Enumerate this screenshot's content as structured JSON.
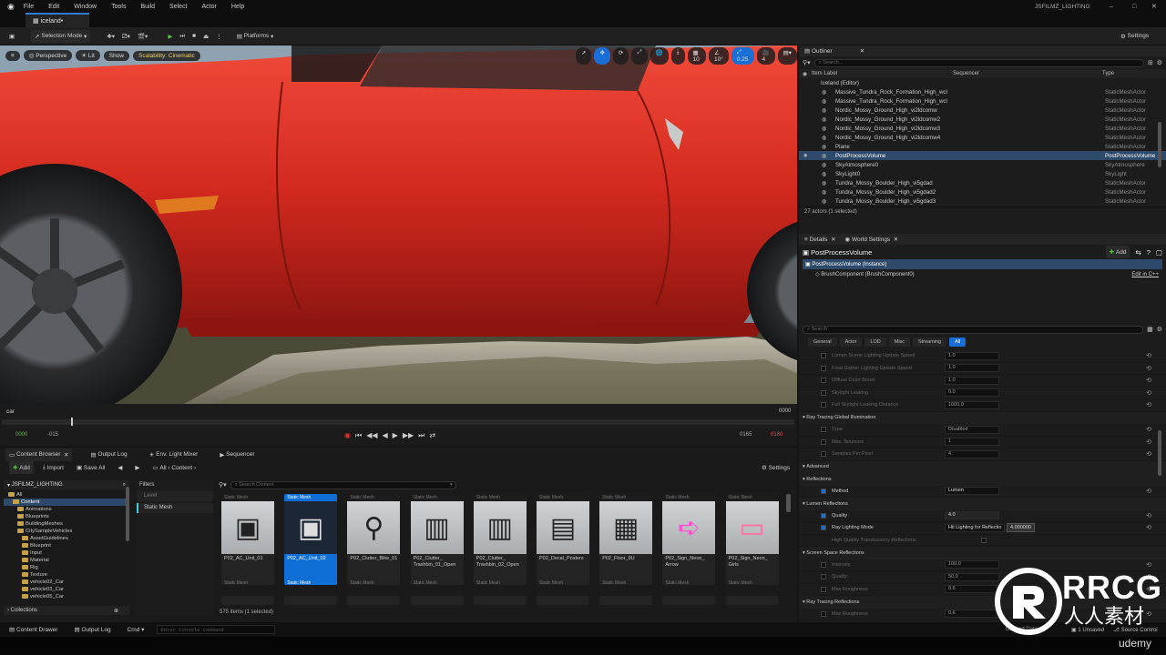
{
  "menu": [
    "File",
    "Edit",
    "Window",
    "Tools",
    "Build",
    "Select",
    "Actor",
    "Help"
  ],
  "project_name": "JSFILMZ_LIGHTING",
  "level_tab": "iceland•",
  "toolbar": {
    "mode": "Selection Mode",
    "platforms": "Platforms",
    "settings": "Settings"
  },
  "viewport": {
    "perspective": "Perspective",
    "lit": "Lit",
    "show": "Show",
    "scalability": "Scalability: Cinematic",
    "grid": "10",
    "angle": "10°",
    "scale": "0.25",
    "camspeed": "4"
  },
  "sequencer": {
    "track": "car",
    "frame_right": "0000",
    "start": "0000",
    "start2": "-015",
    "end": "0165",
    "end2": "0180"
  },
  "dock_tabs": [
    "Content Browser",
    "Output Log",
    "Env. Light Mixer",
    "Sequencer"
  ],
  "content_browser": {
    "add": "Add",
    "import": "Import",
    "save_all": "Save All",
    "path": [
      "All",
      "Content"
    ],
    "settings": "Settings",
    "root": "JSFILMZ_LIGHTING",
    "tree": [
      "All",
      "Content",
      "Animations",
      "Blueprints",
      "BuildingMeshes",
      "CitySampleVehicles",
      "AssetGuidelines",
      "Blueprint",
      "Input",
      "Material",
      "Rig",
      "Texture",
      "vehicle02_Car",
      "vehicle03_Car",
      "vehicle05_Car"
    ],
    "collections": "Collections",
    "filters": "Filters",
    "filter_items": [
      "Level",
      "Static Mesh"
    ],
    "search_placeholder": "Search Content",
    "assets": [
      {
        "type": "Static Mesh",
        "name": "P02_AC_Unit_01",
        "foot": "Static Mesh"
      },
      {
        "type": "Static Mesh",
        "name": "P02_AC_Unit_02",
        "foot": "Static Mesh"
      },
      {
        "type": "Static Mesh",
        "name": "P02_Clutter_Bike_01",
        "foot": "Static Mesh"
      },
      {
        "type": "Static Mesh",
        "name": "P02_Clutter_ Trashbin_01_Open",
        "foot": "Static Mesh"
      },
      {
        "type": "Static Mesh",
        "name": "P02_Clutter_ Trashbin_02_Open",
        "foot": "Static Mesh"
      },
      {
        "type": "Static Mesh",
        "name": "P02_Decal_Posters",
        "foot": "Static Mesh"
      },
      {
        "type": "Static Mesh",
        "name": "P02_Floor_9U",
        "foot": "Static Mesh"
      },
      {
        "type": "Static Mesh",
        "name": "P02_Sign_Neon_ Arrow",
        "foot": "Static Mesh"
      },
      {
        "type": "Static Mesh",
        "name": "P02_Sign_Neon_ Girls",
        "foot": "Static Mesh"
      }
    ],
    "count": "575 items (1 selected)"
  },
  "outliner": {
    "title": "Outliner",
    "search_placeholder": "Search...",
    "col_label": "Item Label",
    "col_seq": "Sequencer",
    "col_type": "Type",
    "root": "Iceland (Editor)",
    "rows": [
      {
        "label": "Massive_Tundra_Rock_Formation_High_wcl",
        "type": "StaticMeshActor"
      },
      {
        "label": "Massive_Tundra_Rock_Formation_High_wcl",
        "type": "StaticMeshActor"
      },
      {
        "label": "Nordic_Mossy_Ground_High_vi2ldcomw",
        "type": "StaticMeshActor"
      },
      {
        "label": "Nordic_Mossy_Ground_High_vi2ldcomw2",
        "type": "StaticMeshActor"
      },
      {
        "label": "Nordic_Mossy_Ground_High_vi2ldcomw3",
        "type": "StaticMeshActor"
      },
      {
        "label": "Nordic_Mossy_Ground_High_vi2ldcomw4",
        "type": "StaticMeshActor"
      },
      {
        "label": "Plane",
        "type": "StaticMeshActor"
      },
      {
        "label": "PostProcessVolume",
        "type": "PostProcessVolume"
      },
      {
        "label": "SkyAtmosphere0",
        "type": "SkyAtmosphere"
      },
      {
        "label": "SkyLight0",
        "type": "SkyLight"
      },
      {
        "label": "Tundra_Mossy_Boulder_High_vi5gdad",
        "type": "StaticMeshActor"
      },
      {
        "label": "Tundra_Mossy_Boulder_High_vi5gdad2",
        "type": "StaticMeshActor"
      },
      {
        "label": "Tundra_Mossy_Boulder_High_vi5gdad3",
        "type": "StaticMeshActor"
      },
      {
        "label": "Tundra_Rocky_Ground_High_vi1qbjqmw",
        "type": "StaticMeshActor"
      }
    ],
    "selected_index": 7,
    "status": "27 actors (1 selected)"
  },
  "details": {
    "tab": "Details",
    "tab2": "World Settings",
    "object": "PostProcessVolume",
    "add": "Add",
    "instance": "PostProcessVolume (Instance)",
    "component": "BrushComponent (BrushComponent0)",
    "edit": "Edit in C++",
    "search_placeholder": "Search",
    "filter_tabs": [
      "General",
      "Actor",
      "LOD",
      "Misc",
      "Streaming",
      "All"
    ],
    "lumen_rows": [
      {
        "name": "Lumen Scene Lighting Update Speed",
        "value": "1.0"
      },
      {
        "name": "Final Gather Lighting Update Speed",
        "value": "1.0"
      },
      {
        "name": "Diffuse Color Boost",
        "value": "1.0"
      },
      {
        "name": "Skylight Leaking",
        "value": "0.0"
      },
      {
        "name": "Full Skylight Leaking Distance",
        "value": "1000.0"
      }
    ],
    "rtgi_header": "Ray Tracing Global Illumination",
    "rtgi_rows": [
      {
        "name": "Type",
        "value": "Disabled"
      },
      {
        "name": "Max. Bounces",
        "value": "1"
      },
      {
        "name": "Samples Per Pixel",
        "value": "4"
      }
    ],
    "advanced": "Advanced",
    "reflections": "Reflections",
    "method_label": "Method",
    "method_value": "Lumen",
    "lumen_refl": "Lumen Reflections",
    "quality_label": "Quality",
    "quality_value": "4.0",
    "rlm_label": "Ray Lighting Mode",
    "rlm_value": "Hit Lighting for Reflectio",
    "tooltip": "4.000000",
    "hqt_label": "High Quality Translucency Reflections",
    "ssr_header": "Screen Space Reflections",
    "ssr_rows": [
      {
        "name": "Intensity",
        "value": "100.0"
      },
      {
        "name": "Quality",
        "value": "50.0"
      },
      {
        "name": "Max Roughness",
        "value": "0.6"
      }
    ],
    "rtr_header": "Ray Tracing Reflections",
    "rtr_rows": [
      {
        "name": "Max Roughness",
        "value": "0.6"
      }
    ]
  },
  "status": {
    "drawer": "Content Drawer",
    "output": "Output Log",
    "cmd": "Cmd",
    "console_placeholder": "Enter Console Command",
    "unsaved": "1 Unsaved",
    "source": "Source Control",
    "derived": "Derived Data"
  },
  "watermark": {
    "brand": "RRCG",
    "sub": "人人素材",
    "corner": "udemy"
  },
  "colors": {
    "accent": "#1a6fd6",
    "car": "#d42a1f",
    "folder": "#c7a04a"
  }
}
